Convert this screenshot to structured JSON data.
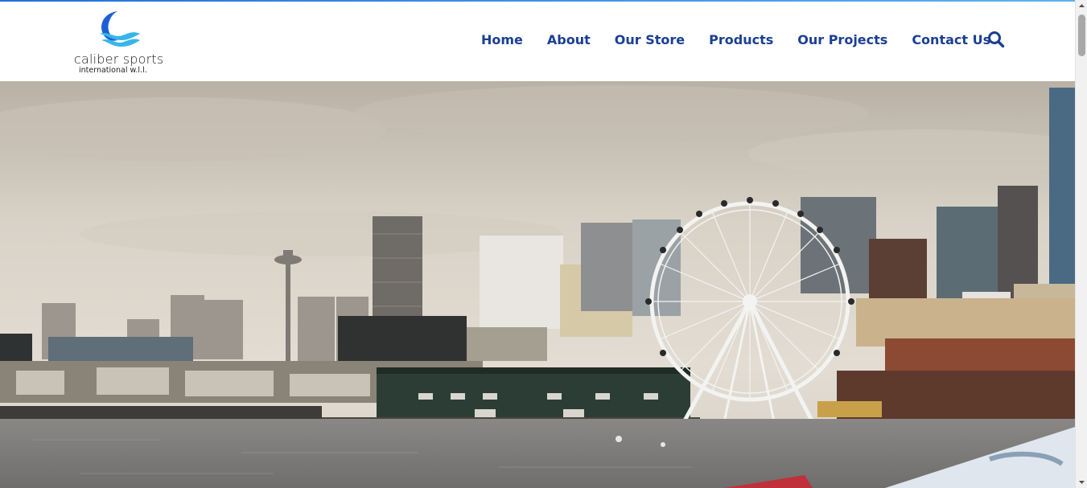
{
  "logo": {
    "name": "caliber sports",
    "sub": "international w.l.l.",
    "colors": {
      "wave_dark": "#1f5fd6",
      "wave_light": "#35b6ea"
    }
  },
  "nav": {
    "items": [
      {
        "label": "Home"
      },
      {
        "label": "About"
      },
      {
        "label": "Our Store"
      },
      {
        "label": "Products"
      },
      {
        "label": "Our Projects"
      },
      {
        "label": "Contact Us"
      }
    ],
    "color": "#1b3f94"
  },
  "search": {
    "icon": "search-icon"
  },
  "hero": {
    "image": "city-waterfront-skyline-with-ferris-wheel"
  },
  "scrollbar": {
    "icons": [
      "scroll-up-arrow-icon",
      "scroll-down-arrow-icon"
    ]
  }
}
